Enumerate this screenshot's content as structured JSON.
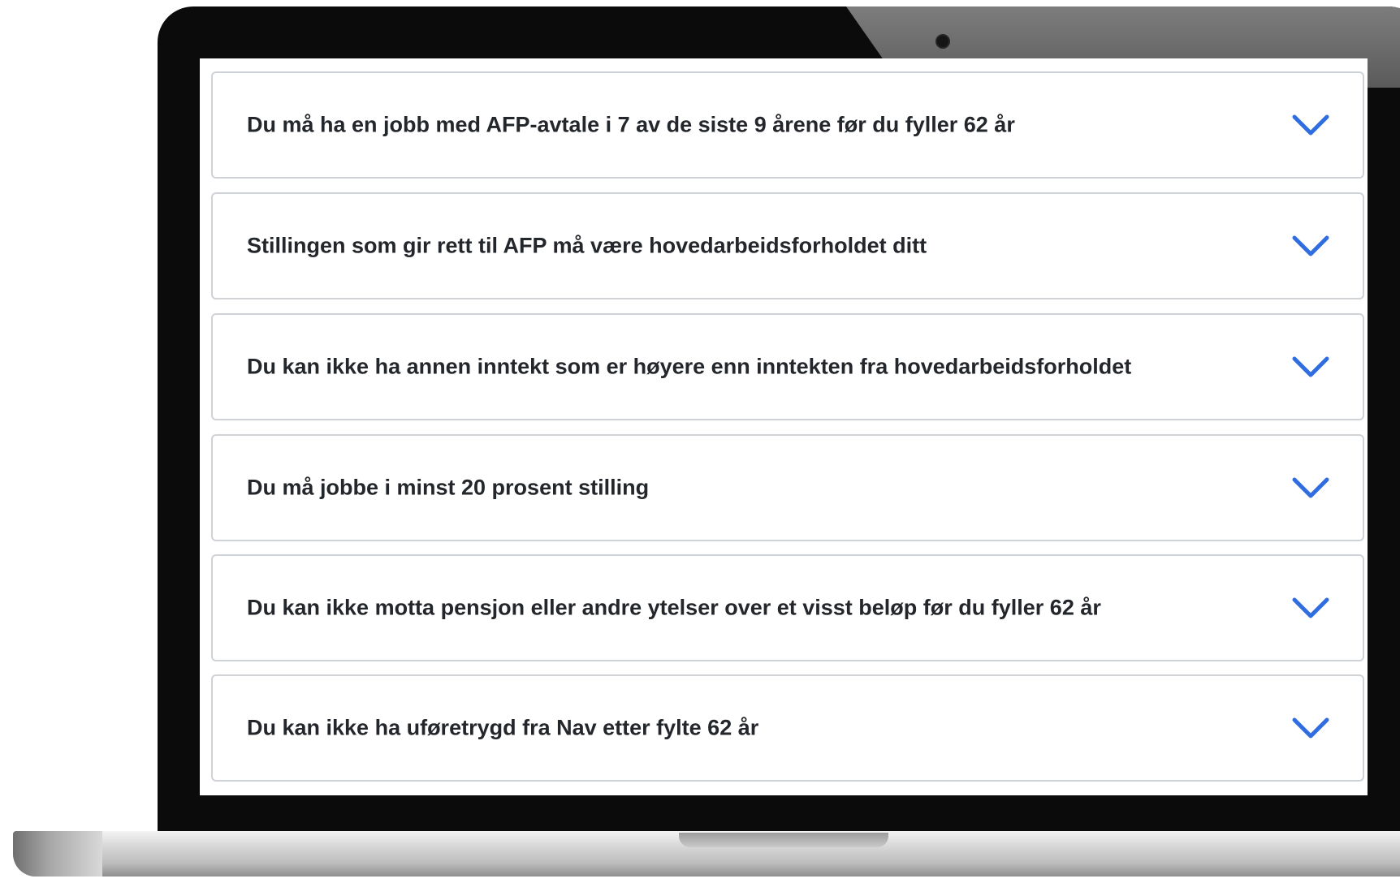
{
  "accordion": {
    "items": [
      {
        "label": "Du må ha en jobb med AFP-avtale i 7 av de siste 9 årene før du fyller 62 år",
        "icon": "chevron-down-icon"
      },
      {
        "label": "Stillingen som gir rett til AFP må være hovedarbeidsforholdet ditt",
        "icon": "chevron-down-icon"
      },
      {
        "label": "Du kan ikke ha annen inntekt som er høyere enn inntekten fra hovedarbeidsforholdet",
        "icon": "chevron-down-icon"
      },
      {
        "label": "Du må jobbe i minst 20 prosent stilling",
        "icon": "chevron-down-icon"
      },
      {
        "label": "Du kan ikke motta pensjon eller andre ytelser over et visst beløp før du fyller 62 år",
        "icon": "chevron-down-icon"
      },
      {
        "label": "Du kan ikke ha uføretrygd fra Nav etter fylte 62 år",
        "icon": "chevron-down-icon"
      }
    ]
  },
  "colors": {
    "chevron": "#2f6de1",
    "title_text": "#23262a",
    "panel_border": "#cfd2d6"
  }
}
